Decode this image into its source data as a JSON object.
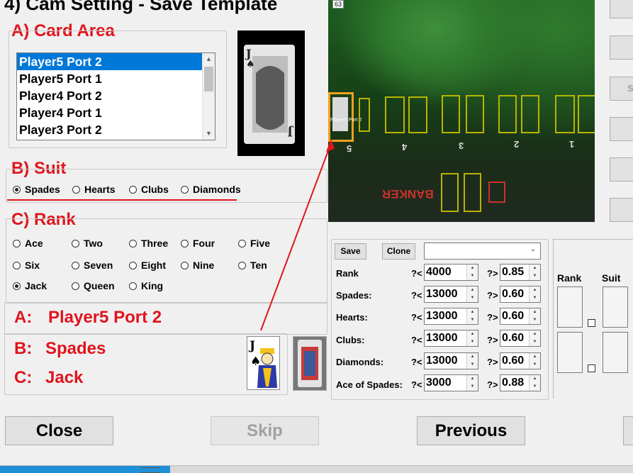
{
  "title": "4) Cam Setting - Save Template",
  "card_area": {
    "heading": "A) Card Area",
    "items": [
      "Player5 Port 2",
      "Player5 Port 1",
      "Player4 Port 2",
      "Player4 Port 1",
      "Player3 Port 2"
    ],
    "selected": "Player5 Port 2"
  },
  "suit": {
    "heading": "B) Suit",
    "options": [
      "Spades",
      "Hearts",
      "Clubs",
      "Diamonds"
    ],
    "selected": "Spades"
  },
  "rank": {
    "heading": "C) Rank",
    "options": [
      "Ace",
      "Two",
      "Three",
      "Four",
      "Five",
      "Six",
      "Seven",
      "Eight",
      "Nine",
      "Ten",
      "Jack",
      "Queen",
      "King"
    ],
    "selected": "Jack"
  },
  "result": {
    "a_label": "A:",
    "a_value": "Player5 Port 2",
    "b_label": "B:",
    "b_value": "Spades",
    "c_label": "C:",
    "c_value": "Jack"
  },
  "camera": {
    "frame_number": "63",
    "slot_label": "Player5 Port 2",
    "slot_numbers": [
      "5",
      "4",
      "3",
      "2",
      "1"
    ],
    "banker_text": "BANKER",
    "colors": {
      "highlight": "#f0a020",
      "slot": "#b8b400",
      "arrow": "#e0141c"
    }
  },
  "template_panel": {
    "save_label": "Save",
    "clone_label": "Clone",
    "dropdown_value": "",
    "rows": [
      {
        "label": "Rank",
        "op1": "?<",
        "val1": "4000",
        "op2": "?>",
        "val2": "0.85"
      },
      {
        "label": "Spades:",
        "op1": "?<",
        "val1": "13000",
        "op2": "?>",
        "val2": "0.60"
      },
      {
        "label": "Hearts:",
        "op1": "?<",
        "val1": "13000",
        "op2": "?>",
        "val2": "0.60"
      },
      {
        "label": "Clubs:",
        "op1": "?<",
        "val1": "13000",
        "op2": "?>",
        "val2": "0.60"
      },
      {
        "label": "Diamonds:",
        "op1": "?<",
        "val1": "13000",
        "op2": "?>",
        "val2": "0.60"
      },
      {
        "label": "Ace of Spades:",
        "op1": "?<",
        "val1": "3000",
        "op2": "?>",
        "val2": "0.88"
      }
    ]
  },
  "side_panel": {
    "rank_label": "Rank",
    "suit_label": "Suit",
    "partial_button": "S"
  },
  "buttons": {
    "close": "Close",
    "skip": "Skip",
    "previous": "Previous"
  }
}
